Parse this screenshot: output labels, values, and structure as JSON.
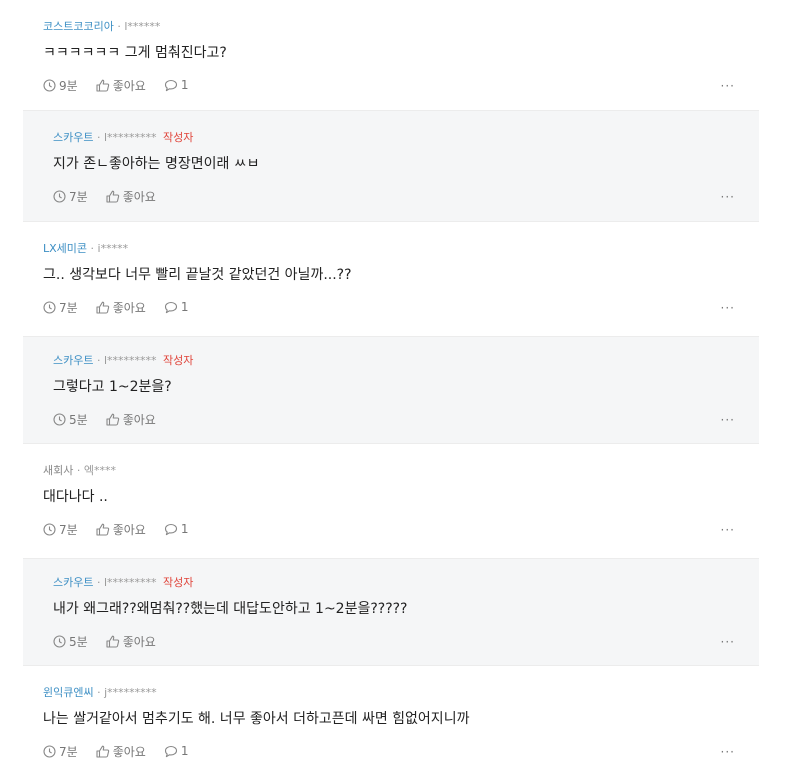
{
  "comments": [
    {
      "author": "코스트코코리아",
      "uid": "l******",
      "writer_badge": "",
      "text": "ㅋㅋㅋㅋㅋㅋ 그게 멈춰진다고?",
      "time": "9분",
      "like": "좋아요",
      "replies": "1"
    },
    {
      "author": "스카우트",
      "uid": "l*********",
      "writer_badge": "작성자",
      "text": "지가 존ㄴ좋아하는 명장면이래 ㅆㅂ",
      "time": "7분",
      "like": "좋아요",
      "replies": ""
    },
    {
      "author": "LX세미콘",
      "uid": "i*****",
      "writer_badge": "",
      "text": "그.. 생각보다 너무 빨리 끝날것 같았던건 아닐까...??",
      "time": "7분",
      "like": "좋아요",
      "replies": "1"
    },
    {
      "author": "스카우트",
      "uid": "l*********",
      "writer_badge": "작성자",
      "text": "그렇다고 1~2분을?",
      "time": "5분",
      "like": "좋아요",
      "replies": ""
    },
    {
      "author": "새회사",
      "uid": "엑****",
      "writer_badge": "",
      "text": "대다나다 ..",
      "time": "7분",
      "like": "좋아요",
      "replies": "1"
    },
    {
      "author": "스카우트",
      "uid": "l*********",
      "writer_badge": "작성자",
      "text": "내가 왜그래??왜멈춰??했는데 대답도안하고 1~2분을?????",
      "time": "5분",
      "like": "좋아요",
      "replies": ""
    },
    {
      "author": "윈익큐엔씨",
      "uid": "j*********",
      "writer_badge": "",
      "text": "나는 쌀거같아서 멈추기도 해. 너무 좋아서 더하고픈데 싸면 힘없어지니까",
      "time": "7분",
      "like": "좋아요",
      "replies": "1"
    }
  ],
  "ui": {
    "separator": "·",
    "more": "···"
  },
  "colors": {
    "author_link": "#3d8fc4",
    "writer_badge": "#e0453b",
    "reply_bg": "#f5f6f7",
    "divider": "#ececec"
  },
  "icons": {
    "time": "clock-icon",
    "like": "thumbs-up-icon",
    "reply": "speech-bubble-icon",
    "more": "more-dots-icon"
  }
}
